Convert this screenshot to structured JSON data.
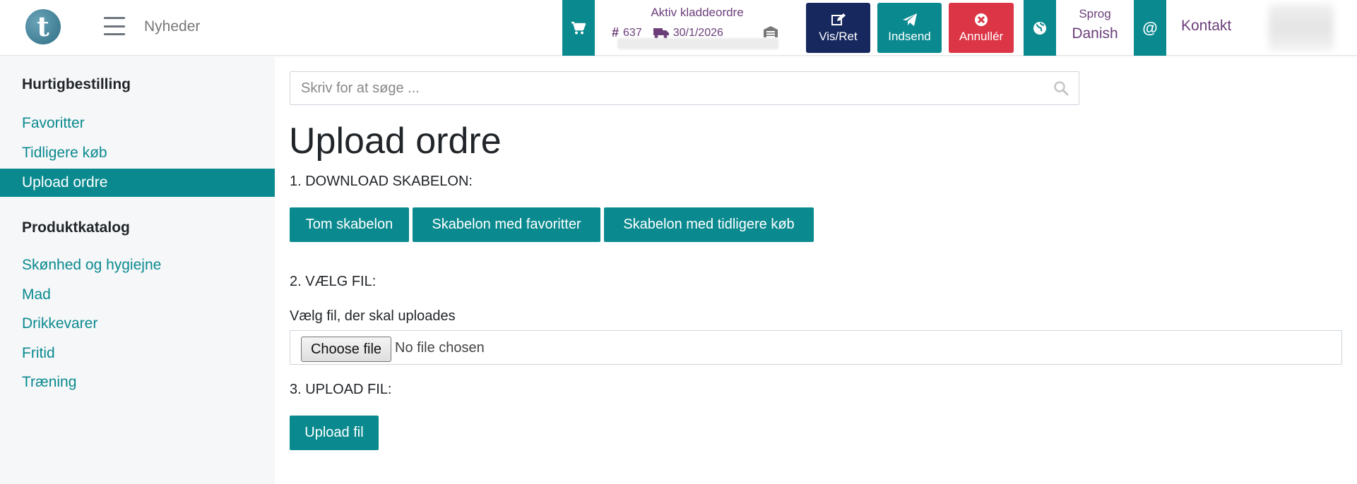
{
  "header": {
    "logo_letter": "t",
    "news_link": "Nyheder",
    "draft": {
      "title": "Aktiv kladdeordre",
      "order_number": "637",
      "delivery_date": "30/1/2026"
    },
    "buttons": {
      "view_edit": "Vis/Ret",
      "submit": "Indsend",
      "cancel": "Annullér"
    },
    "language": {
      "label": "Sprog",
      "value": "Danish"
    },
    "contact": "Kontakt",
    "colors": {
      "teal": "#0a8a8f",
      "navy": "#17285e",
      "red": "#dc3545",
      "purple": "#6b3e7a"
    }
  },
  "sidebar": {
    "quick_order_heading": "Hurtigbestilling",
    "quick_items": [
      {
        "label": "Favoritter",
        "active": false
      },
      {
        "label": "Tidligere køb",
        "active": false
      },
      {
        "label": "Upload ordre",
        "active": true
      }
    ],
    "catalog_heading": "Produktkatalog",
    "catalog_items": [
      {
        "label": "Skønhed og hygiejne"
      },
      {
        "label": "Mad"
      },
      {
        "label": "Drikkevarer"
      },
      {
        "label": "Fritid"
      },
      {
        "label": "Træning"
      }
    ]
  },
  "main": {
    "search_placeholder": "Skriv for at søge ...",
    "title": "Upload ordre",
    "step1": "1. DOWNLOAD SKABELON:",
    "template_buttons": {
      "empty": "Tom skabelon",
      "favorites": "Skabelon med favoritter",
      "previous": "Skabelon med tidligere køb"
    },
    "step2": "2. VÆLG FIL:",
    "file_label": "Vælg fil, der skal uploades",
    "choose_file": "Choose file",
    "no_file": "No file chosen",
    "step3": "3. UPLOAD FIL:",
    "upload_button": "Upload fil"
  }
}
